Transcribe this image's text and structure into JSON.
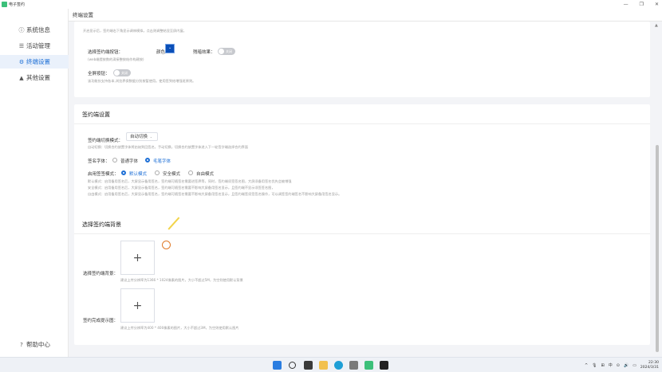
{
  "app": {
    "title": "电子签约"
  },
  "window": {
    "minimize": "—",
    "restore": "❐",
    "close": "✕"
  },
  "sidebar": {
    "items": [
      {
        "label": "系统信息",
        "icon": "info-circle-icon",
        "glyph": "ⓘ"
      },
      {
        "label": "活动管理",
        "icon": "list-icon",
        "glyph": "☰"
      },
      {
        "label": "终端设置",
        "icon": "gear-icon",
        "glyph": "⚙"
      },
      {
        "label": "其他设置",
        "icon": "warning-icon",
        "glyph": "▲"
      }
    ],
    "active_index": 2,
    "help": {
      "label": "帮助中心",
      "glyph": "?"
    }
  },
  "header": {
    "title": "终端设置"
  },
  "card1": {
    "top_hint": "开启显示后，签约端右下角显示调林模拟，点击则调整结显至屏内窗。",
    "sign_button_label": "选择签约端按钮：",
    "color_label": "颜色：",
    "color_value": "#0a4fb8",
    "flash_label": "残暗效果：",
    "flash_toggle": "关闭",
    "sign_hint": "(web端提按数的滴接整按结作构建按)",
    "fullscreen_label": "全屏按钮：",
    "fullscreen_toggle": "关闭",
    "fullscreen_hint": "该功能仅支持各本,浏览界保数据分别按暂使用。使用签到给增强班原则。"
  },
  "card2": {
    "title": "签约端设置",
    "switch_mode_label": "签约端切换模式：",
    "switch_mode_value": "自动切换",
    "switch_mode_hint": "自动切换：切换合约放置字体将启始到回签名，手动切换，切换合约放置字体进入下一轮签字端选择合约界面",
    "font_label": "签名字体：",
    "font_options": [
      "普通字体",
      "毛笔字体"
    ],
    "font_selected": 1,
    "sign_mode_label": "启用签签模式：",
    "sign_mode_options": [
      "默认模式",
      "安全模式",
      "自由模式"
    ],
    "sign_mode_selected": 0,
    "mode_hints": [
      "默认模式：启用备用签名后，大屏显示备用签名，签约端可随签名需要进签界等，同时，签约端须签签名图，大屏须备用签名优先会被增强",
      "安全模式：启用备用签名后，大屏显示备用签名，签约端可随签名需要不影响大屏备用签名显示，且签约端不显示须签签名图，",
      "自由模式：启用备用签名后，大屏显示备用签名，签约端可随签名需要不影响大屏备用签名显示，且签约端签须签签名操作，可以调签签约端签名不影响大屏备用签名显示。"
    ]
  },
  "card3": {
    "title": "选择签约端背景",
    "bg_label": "选择签约端背景：",
    "bg_hint": "建议上传分辨率为1366 * 1024像素的图片，大小不超过5M，为空则使用默认背景",
    "done_label": "签约完成提示图：",
    "done_hint": "建议上传分辨率为400 * 400像素的图片，大小不超过3M，为空则使用默认图片",
    "plus": "+"
  },
  "taskbar": {
    "apps": [
      "windows-start-icon",
      "search-icon",
      "task-view-icon",
      "file-explorer-icon",
      "edge-browser-icon",
      "settings-icon",
      "esign-app-icon",
      "terminal-icon"
    ],
    "tray_glyphs": [
      "^",
      "🎙",
      "⊞",
      "中",
      "⊙",
      "🔊",
      "▭"
    ],
    "time": "22:30",
    "date": "2024/3/31"
  }
}
